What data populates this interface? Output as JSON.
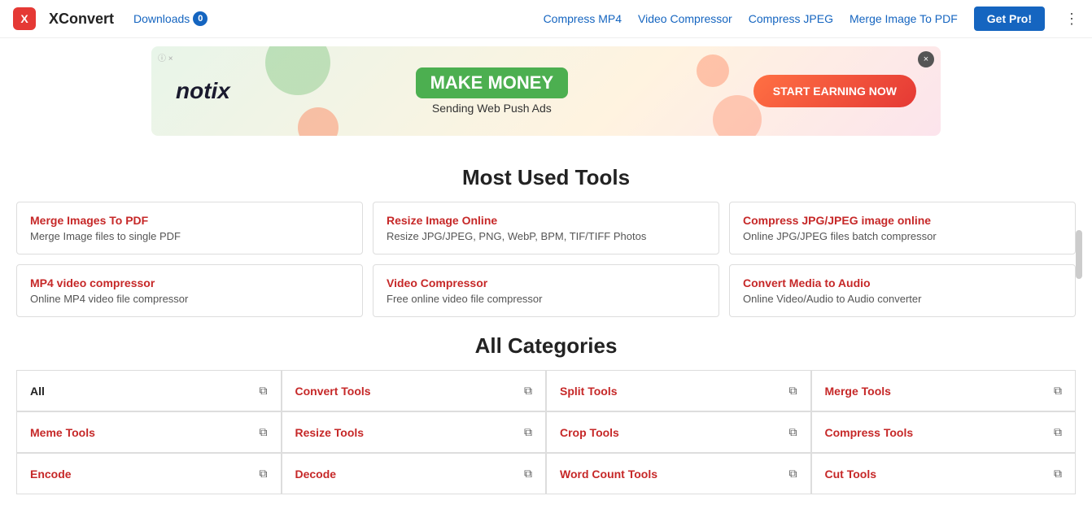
{
  "header": {
    "logo_letter": "X",
    "logo_name": "XConvert",
    "downloads_label": "Downloads",
    "downloads_count": "0",
    "nav_links": [
      {
        "label": "Compress MP4",
        "id": "compress-mp4"
      },
      {
        "label": "Video Compressor",
        "id": "video-compressor"
      },
      {
        "label": "Compress JPEG",
        "id": "compress-jpeg"
      },
      {
        "label": "Merge Image To PDF",
        "id": "merge-image-to-pdf"
      }
    ],
    "get_pro_label": "Get Pro!"
  },
  "ad": {
    "info_label": "ⓘ ×",
    "close_label": "×",
    "brand": "notix",
    "headline": "MAKE MONEY",
    "subtext": "Sending Web Push Ads",
    "cta": "START EARNING NOW"
  },
  "most_used": {
    "title": "Most Used Tools",
    "tools": [
      {
        "title": "Merge Images To PDF",
        "desc": "Merge Image files to single PDF"
      },
      {
        "title": "Resize Image Online",
        "desc": "Resize JPG/JPEG, PNG, WebP, BPM, TIF/TIFF Photos"
      },
      {
        "title": "Compress JPG/JPEG image online",
        "desc": "Online JPG/JPEG files batch compressor"
      },
      {
        "title": "MP4 video compressor",
        "desc": "Online MP4 video file compressor"
      },
      {
        "title": "Video Compressor",
        "desc": "Free online video file compressor"
      },
      {
        "title": "Convert Media to Audio",
        "desc": "Online Video/Audio to Audio converter"
      }
    ]
  },
  "categories": {
    "title": "All Categories",
    "items": [
      {
        "label": "All",
        "red": false
      },
      {
        "label": "Convert Tools",
        "red": true
      },
      {
        "label": "Split Tools",
        "red": true
      },
      {
        "label": "Merge Tools",
        "red": true
      },
      {
        "label": "Meme Tools",
        "red": true
      },
      {
        "label": "Resize Tools",
        "red": true
      },
      {
        "label": "Crop Tools",
        "red": true
      },
      {
        "label": "Compress Tools",
        "red": true
      },
      {
        "label": "Encode",
        "red": true
      },
      {
        "label": "Decode",
        "red": true
      },
      {
        "label": "Word Count Tools",
        "red": true
      },
      {
        "label": "Cut Tools",
        "red": true
      }
    ]
  }
}
